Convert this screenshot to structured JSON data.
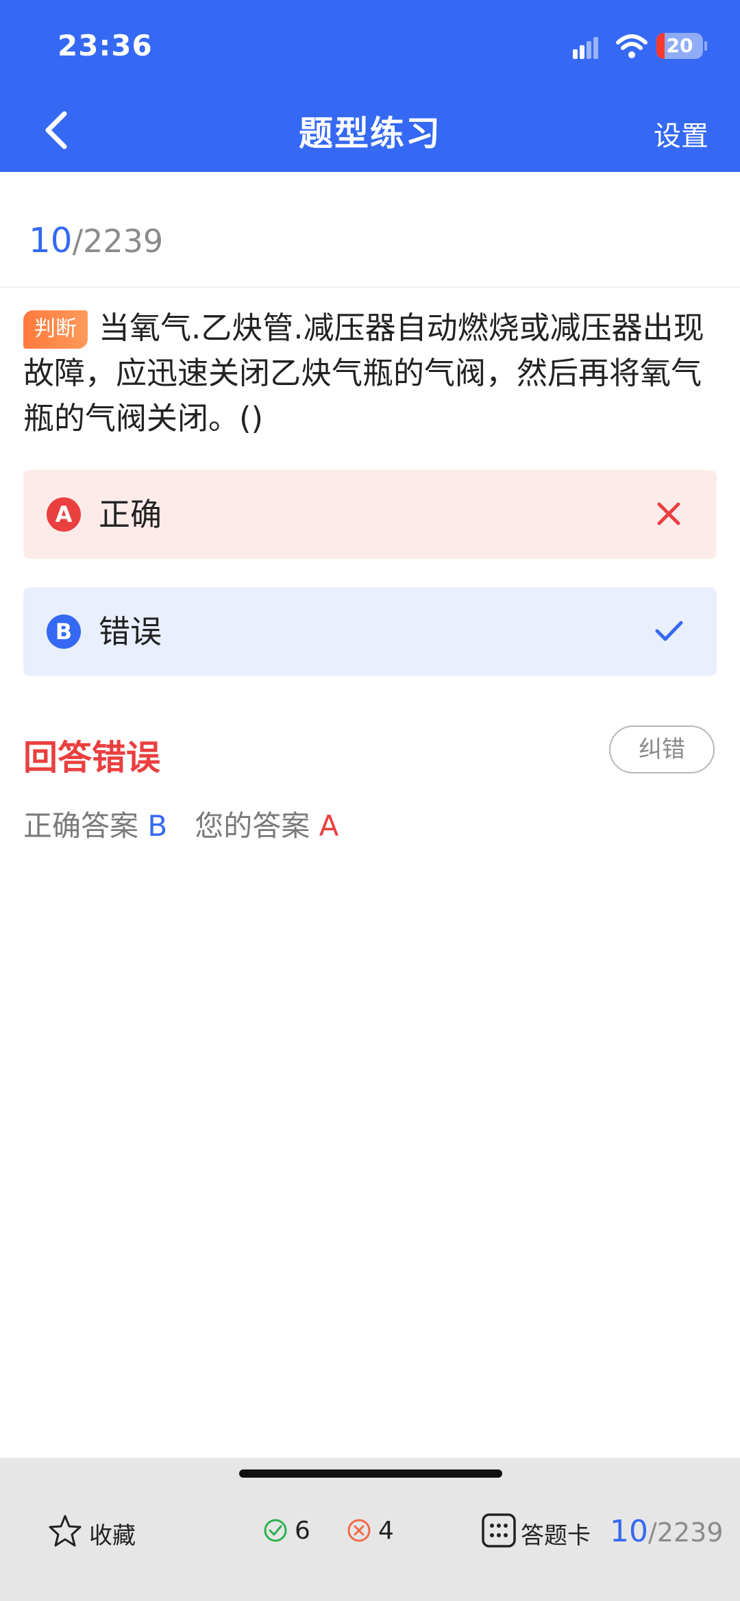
{
  "status_bar": {
    "time": "23:36",
    "battery": "20"
  },
  "header": {
    "title": "题型练习",
    "settings_label": "设置"
  },
  "progress": {
    "current": "10",
    "total": "/2239"
  },
  "question": {
    "tag": "判断",
    "text": "当氧气.乙炔管.减压器自动燃烧或减压器出现故障，应迅速关闭乙炔气瓶的气阀，然后再将氧气瓶的气阀关闭。()"
  },
  "options": [
    {
      "letter": "A",
      "text": "正确",
      "state": "wrong"
    },
    {
      "letter": "B",
      "text": "错误",
      "state": "correct"
    }
  ],
  "result": {
    "title": "回答错误",
    "report_label": "纠错",
    "correct_label": "正确答案",
    "correct_value": "B",
    "your_label": "您的答案",
    "your_value": "A"
  },
  "bottom_bar": {
    "favorite_label": "收藏",
    "correct_count": "6",
    "wrong_count": "4",
    "answer_card_label": "答题卡",
    "current": "10",
    "total": "/2239"
  },
  "colors": {
    "primary": "#3569f3",
    "error": "#ea3f3f",
    "tag": "#ff7a3d"
  },
  "icons": [
    "back-icon",
    "signal-icon",
    "wifi-icon",
    "battery-icon",
    "close-icon",
    "check-icon",
    "star-icon",
    "check-circle-icon",
    "close-circle-icon",
    "grid-icon"
  ]
}
